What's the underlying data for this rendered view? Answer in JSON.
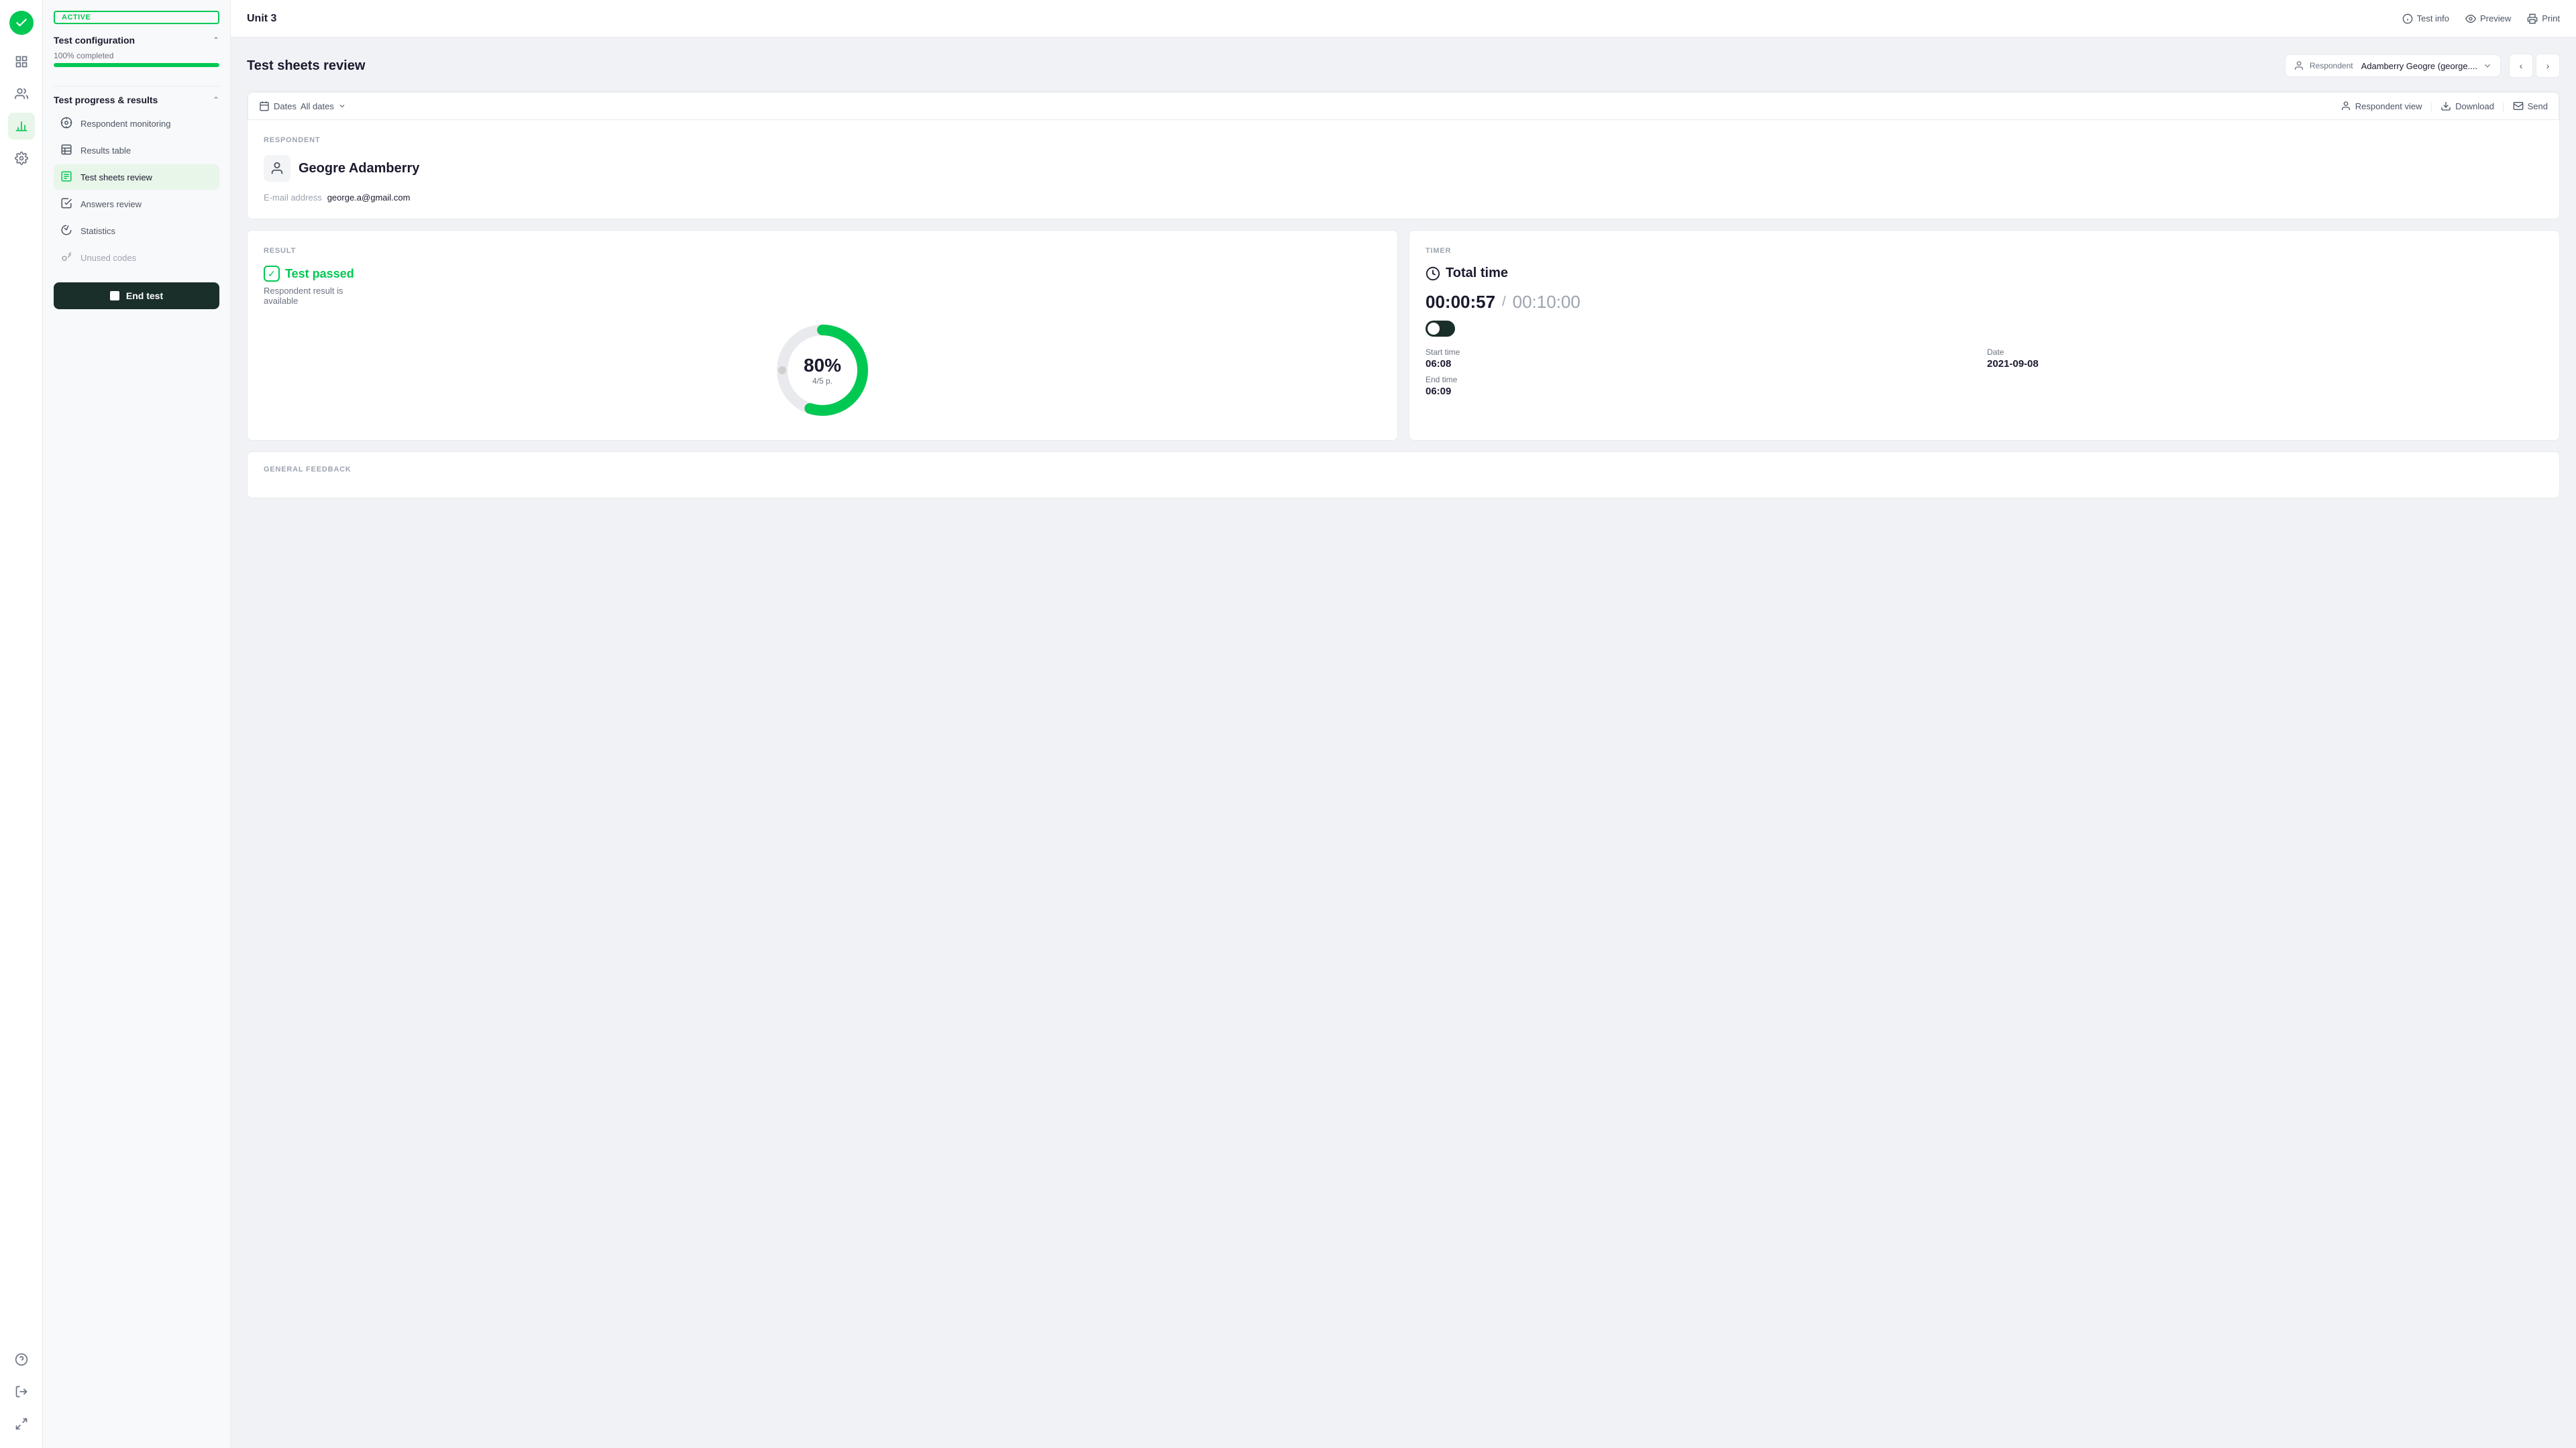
{
  "app": {
    "logo_icon": "check-circle",
    "unit_title": "Unit 3"
  },
  "nav_rail": {
    "items": [
      {
        "name": "grid-icon",
        "label": "Dashboard",
        "active": false
      },
      {
        "name": "users-icon",
        "label": "Users",
        "active": false
      },
      {
        "name": "chart-icon",
        "label": "Analytics",
        "active": true
      },
      {
        "name": "gear-icon",
        "label": "Settings",
        "active": false
      }
    ],
    "bottom_items": [
      {
        "name": "question-icon",
        "label": "Help"
      },
      {
        "name": "exit-icon",
        "label": "Exit"
      },
      {
        "name": "expand-icon",
        "label": "Expand"
      }
    ]
  },
  "sidebar": {
    "active_badge": "ACTIVE",
    "test_config": {
      "title": "Test configuration",
      "progress_label": "100% completed",
      "progress_value": 100
    },
    "test_progress": {
      "title": "Test progress & results",
      "items": [
        {
          "id": "respondent-monitoring",
          "label": "Respondent monitoring",
          "icon": "monitor-icon",
          "active": false,
          "disabled": false
        },
        {
          "id": "results-table",
          "label": "Results table",
          "icon": "table-icon",
          "active": false,
          "disabled": false
        },
        {
          "id": "test-sheets-review",
          "label": "Test sheets review",
          "icon": "sheets-icon",
          "active": true,
          "disabled": false
        },
        {
          "id": "answers-review",
          "label": "Answers review",
          "icon": "check-square-icon",
          "active": false,
          "disabled": false
        },
        {
          "id": "statistics",
          "label": "Statistics",
          "icon": "stats-icon",
          "active": false,
          "disabled": false
        },
        {
          "id": "unused-codes",
          "label": "Unused codes",
          "icon": "key-icon",
          "active": false,
          "disabled": true
        }
      ]
    },
    "end_test_btn": "End test"
  },
  "header": {
    "test_info_label": "Test info",
    "preview_label": "Preview",
    "print_label": "Print"
  },
  "review": {
    "title": "Test sheets review",
    "respondent_label": "Respondent",
    "respondent_name": "Adamberry Geogre (george....",
    "dates_label": "Dates",
    "dates_value": "All dates",
    "respondent_view_label": "Respondent view",
    "download_label": "Download",
    "send_label": "Send"
  },
  "respondent_section": {
    "section_label": "RESPONDENT",
    "full_name": "Geogre Adamberry",
    "email_label": "E-mail address",
    "email_value": "george.a@gmail.com"
  },
  "result_section": {
    "section_label": "RESULT",
    "status": "Test passed",
    "desc_line1": "Respondent result is",
    "desc_line2": "available",
    "percent": "80%",
    "score": "4/5 p.",
    "donut_filled": 80,
    "donut_color": "#00c853",
    "donut_bg": "#e0e0e0"
  },
  "timer_section": {
    "section_label": "TIMER",
    "title": "Total time",
    "elapsed": "00:00:57",
    "separator": "/",
    "total": "00:10:00",
    "start_time_label": "Start time",
    "start_time_value": "06:08",
    "date_label": "Date",
    "date_value": "2021-09-08",
    "end_time_label": "End time",
    "end_time_value": "06:09"
  },
  "general_feedback": {
    "section_label": "GENERAL FEEDBACK"
  }
}
